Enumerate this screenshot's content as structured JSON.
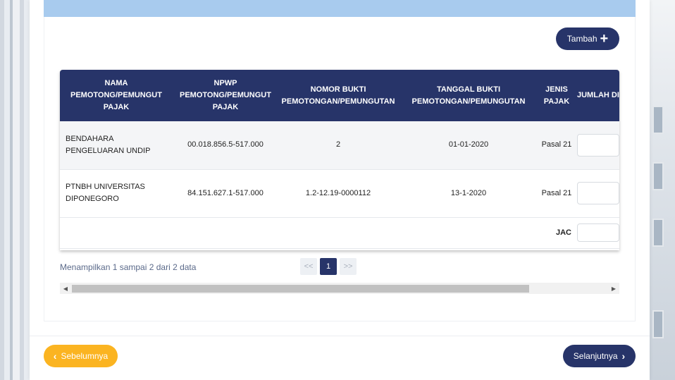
{
  "toolbar": {
    "add_label": "Tambah",
    "add_icon": "plus-icon"
  },
  "table": {
    "headers": [
      "NAMA PEMOTONG/PEMUNGUT PAJAK",
      "NPWP PEMOTONG/PEMUNGUT PAJAK",
      "NOMOR BUKTI PEMOTONGAN/PEMUNGUTAN",
      "TANGGAL BUKTI PEMOTONGAN/PEMUNGUTAN",
      "JENIS PAJAK",
      "JUMLAH DIPOTONG"
    ],
    "rows": [
      {
        "nama": "BENDAHARA PENGELUARAN UNDIP",
        "npwp": "00.018.856.5-517.000",
        "nomor": "2",
        "tanggal": "01-01-2020",
        "jenis": "Pasal 21"
      },
      {
        "nama": "PTNBH UNIVERSITAS DIPONEGORO",
        "npwp": "84.151.627.1-517.000",
        "nomor": "1.2-12.19-0000112",
        "tanggal": "13-1-2020",
        "jenis": "Pasal 21"
      }
    ],
    "total_label": "JAC"
  },
  "pagination": {
    "info": "Menampilkan 1 sampai 2 dari 2 data",
    "prev": "<<",
    "current": "1",
    "next": ">>"
  },
  "footer": {
    "prev_label": "Sebelumnya",
    "next_label": "Selanjutnya"
  },
  "colors": {
    "primary": "#273469",
    "accent": "#fbb421",
    "top_band": "#a8cbee"
  }
}
